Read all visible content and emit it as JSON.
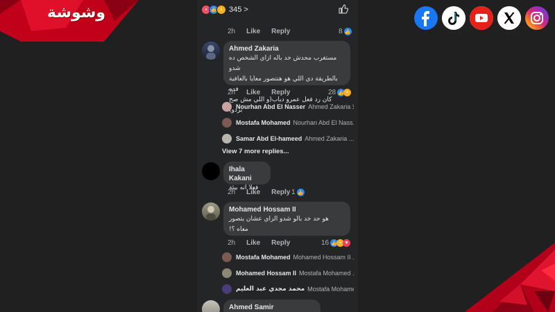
{
  "brand": {
    "logo_text": "وشوشة",
    "colors": {
      "red": "#d0021b",
      "dark_red": "#7a0010",
      "bg": "#202020",
      "panel": "#242526",
      "bubble": "#3a3b3c"
    }
  },
  "social_icons": [
    {
      "name": "facebook-icon",
      "color": "#1877f2"
    },
    {
      "name": "tiktok-icon",
      "color": "#000000"
    },
    {
      "name": "youtube-icon",
      "color": "#ff0000"
    },
    {
      "name": "x-icon",
      "color": "#000000"
    },
    {
      "name": "instagram-icon",
      "color": "#d62976"
    }
  ],
  "post_bar": {
    "reaction_count": "345",
    "chevron": ">",
    "icons": [
      "angry-reaction",
      "like-reaction",
      "haha-reaction"
    ]
  },
  "actions": {
    "time": "2h",
    "like": "Like",
    "reply": "Reply"
  },
  "top_meta": {
    "count": "8"
  },
  "comments": [
    {
      "author": "Ahmed Zakaria",
      "lines": [
        "مستغرب محدش خد باله ازاي الشخص ده شدو",
        "بالطريقة دي اللي هو هنتصور معايا بالعافية فده",
        "كان رد فعل عمرو دياب(و اللي مش صح بردو)"
      ],
      "count": "28",
      "replies": [
        {
          "author": "Nourhan Abd El Nasser",
          "text": "Ahmed Zakaria لا..."
        },
        {
          "author": "Mostafa Mohamed",
          "text": "Nourhan Abd El Nass..."
        },
        {
          "author": "Samar Abd El-hameed",
          "text": "Ahmed Zakaria ..."
        }
      ],
      "view_more": "View 7 more replies..."
    },
    {
      "author": "Ihala Kakani",
      "lines": [
        "فعلا انه بيئة"
      ],
      "count": "1",
      "replies": []
    },
    {
      "author": "Mohamed Hossam II",
      "lines": [
        "هو حد خد بالو شدو الزاي  عشان يتصور",
        "معاه ؟!"
      ],
      "count": "16",
      "replies": [
        {
          "author": "Mostafa Mohamed",
          "text": "Mohamed Hossam II ..."
        },
        {
          "author": "Mohamed Hossam II",
          "text": "Mostafa Mohamed ..."
        },
        {
          "author": "محمد مجدي عبد العليم",
          "text": "Mostafa Mohamed ايو..."
        }
      ]
    },
    {
      "author": "Ahmed Samir",
      "lines": [],
      "count": "",
      "replies": []
    }
  ]
}
